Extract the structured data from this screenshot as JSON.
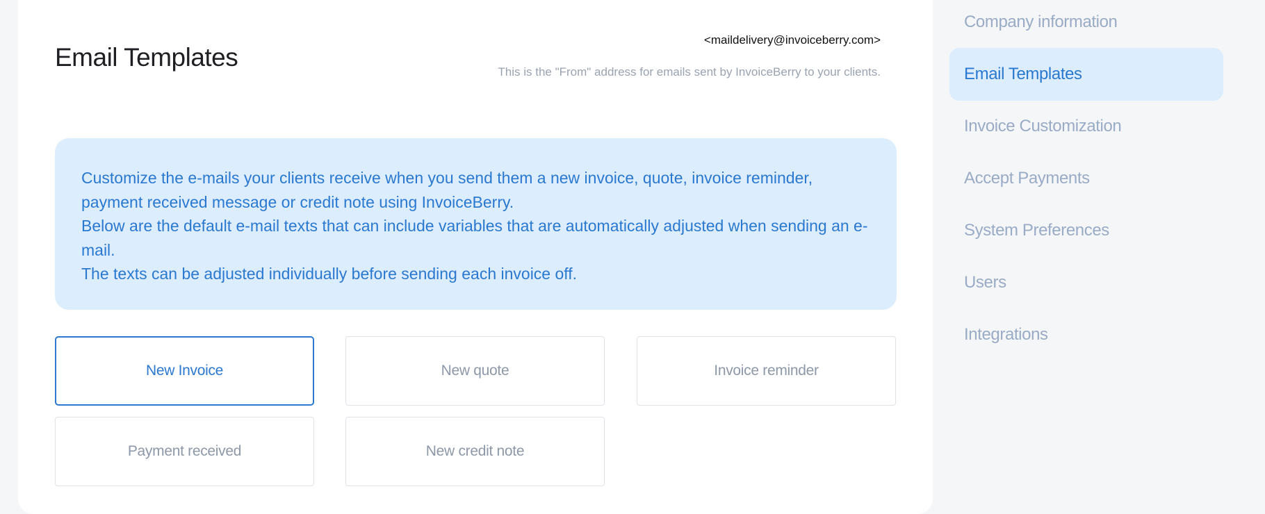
{
  "header": {
    "title": "Email Templates",
    "from_email": "<maildelivery@invoiceberry.com>",
    "from_hint": "This is the \"From\" address for emails sent by InvoiceBerry to your clients."
  },
  "info": {
    "line1": "Customize the e-mails your clients receive when you send them a new invoice, quote, invoice reminder, payment received message or credit note using InvoiceBerry.",
    "line2": "Below are the default e-mail texts that can include variables that are automatically adjusted when sending an e-mail.",
    "line3": "The texts can be adjusted individually before sending each invoice off."
  },
  "templates": [
    {
      "label": "New Invoice",
      "active": true
    },
    {
      "label": "New quote",
      "active": false
    },
    {
      "label": "Invoice reminder",
      "active": false
    },
    {
      "label": "Payment received",
      "active": false
    },
    {
      "label": "New credit note",
      "active": false
    }
  ],
  "sidebar": {
    "items": [
      {
        "label": "Company information",
        "active": false
      },
      {
        "label": "Email Templates",
        "active": true
      },
      {
        "label": "Invoice Customization",
        "active": false
      },
      {
        "label": "Accept Payments",
        "active": false
      },
      {
        "label": "System Preferences",
        "active": false
      },
      {
        "label": "Users",
        "active": false
      },
      {
        "label": "Integrations",
        "active": false
      }
    ]
  },
  "colors": {
    "accent": "#2b78d0",
    "accent_bg": "#dcedfd",
    "muted_text": "#9aabc6",
    "page_bg": "#f4f6f8"
  }
}
